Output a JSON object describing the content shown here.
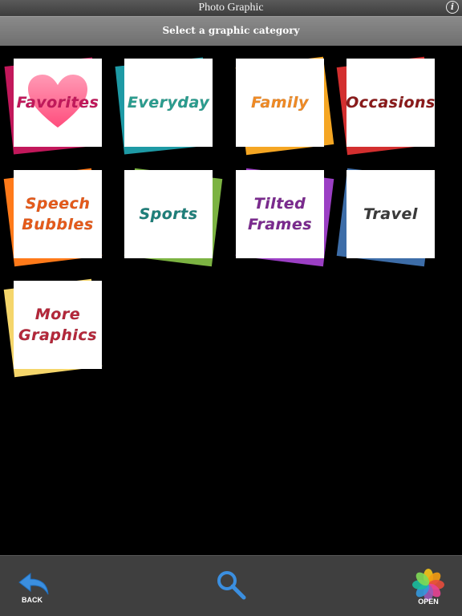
{
  "titlebar": {
    "title": "Photo Graphic",
    "info_icon": "i"
  },
  "subbar": {
    "prompt": "Select a graphic category"
  },
  "categories": [
    {
      "id": "favorites",
      "lines": [
        "Favorites"
      ],
      "back_color": "#c2185b",
      "text_color": "#c2185b"
    },
    {
      "id": "everyday",
      "lines": [
        "Everyday"
      ],
      "back_color": "#1e9aa5",
      "text_color": "#2a9d8f"
    },
    {
      "id": "family",
      "lines": [
        "Family"
      ],
      "back_color": "#f5a623",
      "text_color": "#f08a24"
    },
    {
      "id": "occasions",
      "lines": [
        "Occasions"
      ],
      "back_color": "#d32f2f",
      "text_color": "#8b1a1a"
    },
    {
      "id": "speech-bubbles",
      "lines": [
        "Speech",
        "Bubbles"
      ],
      "back_color": "#ff7a1a",
      "text_color": "#e65a1a"
    },
    {
      "id": "sports",
      "lines": [
        "Sports"
      ],
      "back_color": "#7cb342",
      "text_color": "#1e7f7a"
    },
    {
      "id": "tilted-frames",
      "lines": [
        "Tilted",
        "Frames"
      ],
      "back_color": "#9b3fc4",
      "text_color": "#7b2a8f"
    },
    {
      "id": "travel",
      "lines": [
        "Travel"
      ],
      "back_color": "#3d6da8",
      "text_color": "#3a3a3a"
    },
    {
      "id": "more-graphics",
      "lines": [
        "More",
        "Graphics"
      ],
      "back_color": "#f5d66b",
      "text_color": "#b5273a"
    }
  ],
  "bottombar": {
    "back_label": "BACK",
    "open_label": "OPEN"
  },
  "colors": {
    "titlebar_bg": "#484848",
    "subbar_bg": "#7d7d7d",
    "bottombar_bg": "#3f3f3f",
    "back_arrow": "#3b8fe0",
    "search_icon": "#3b8fe0"
  }
}
